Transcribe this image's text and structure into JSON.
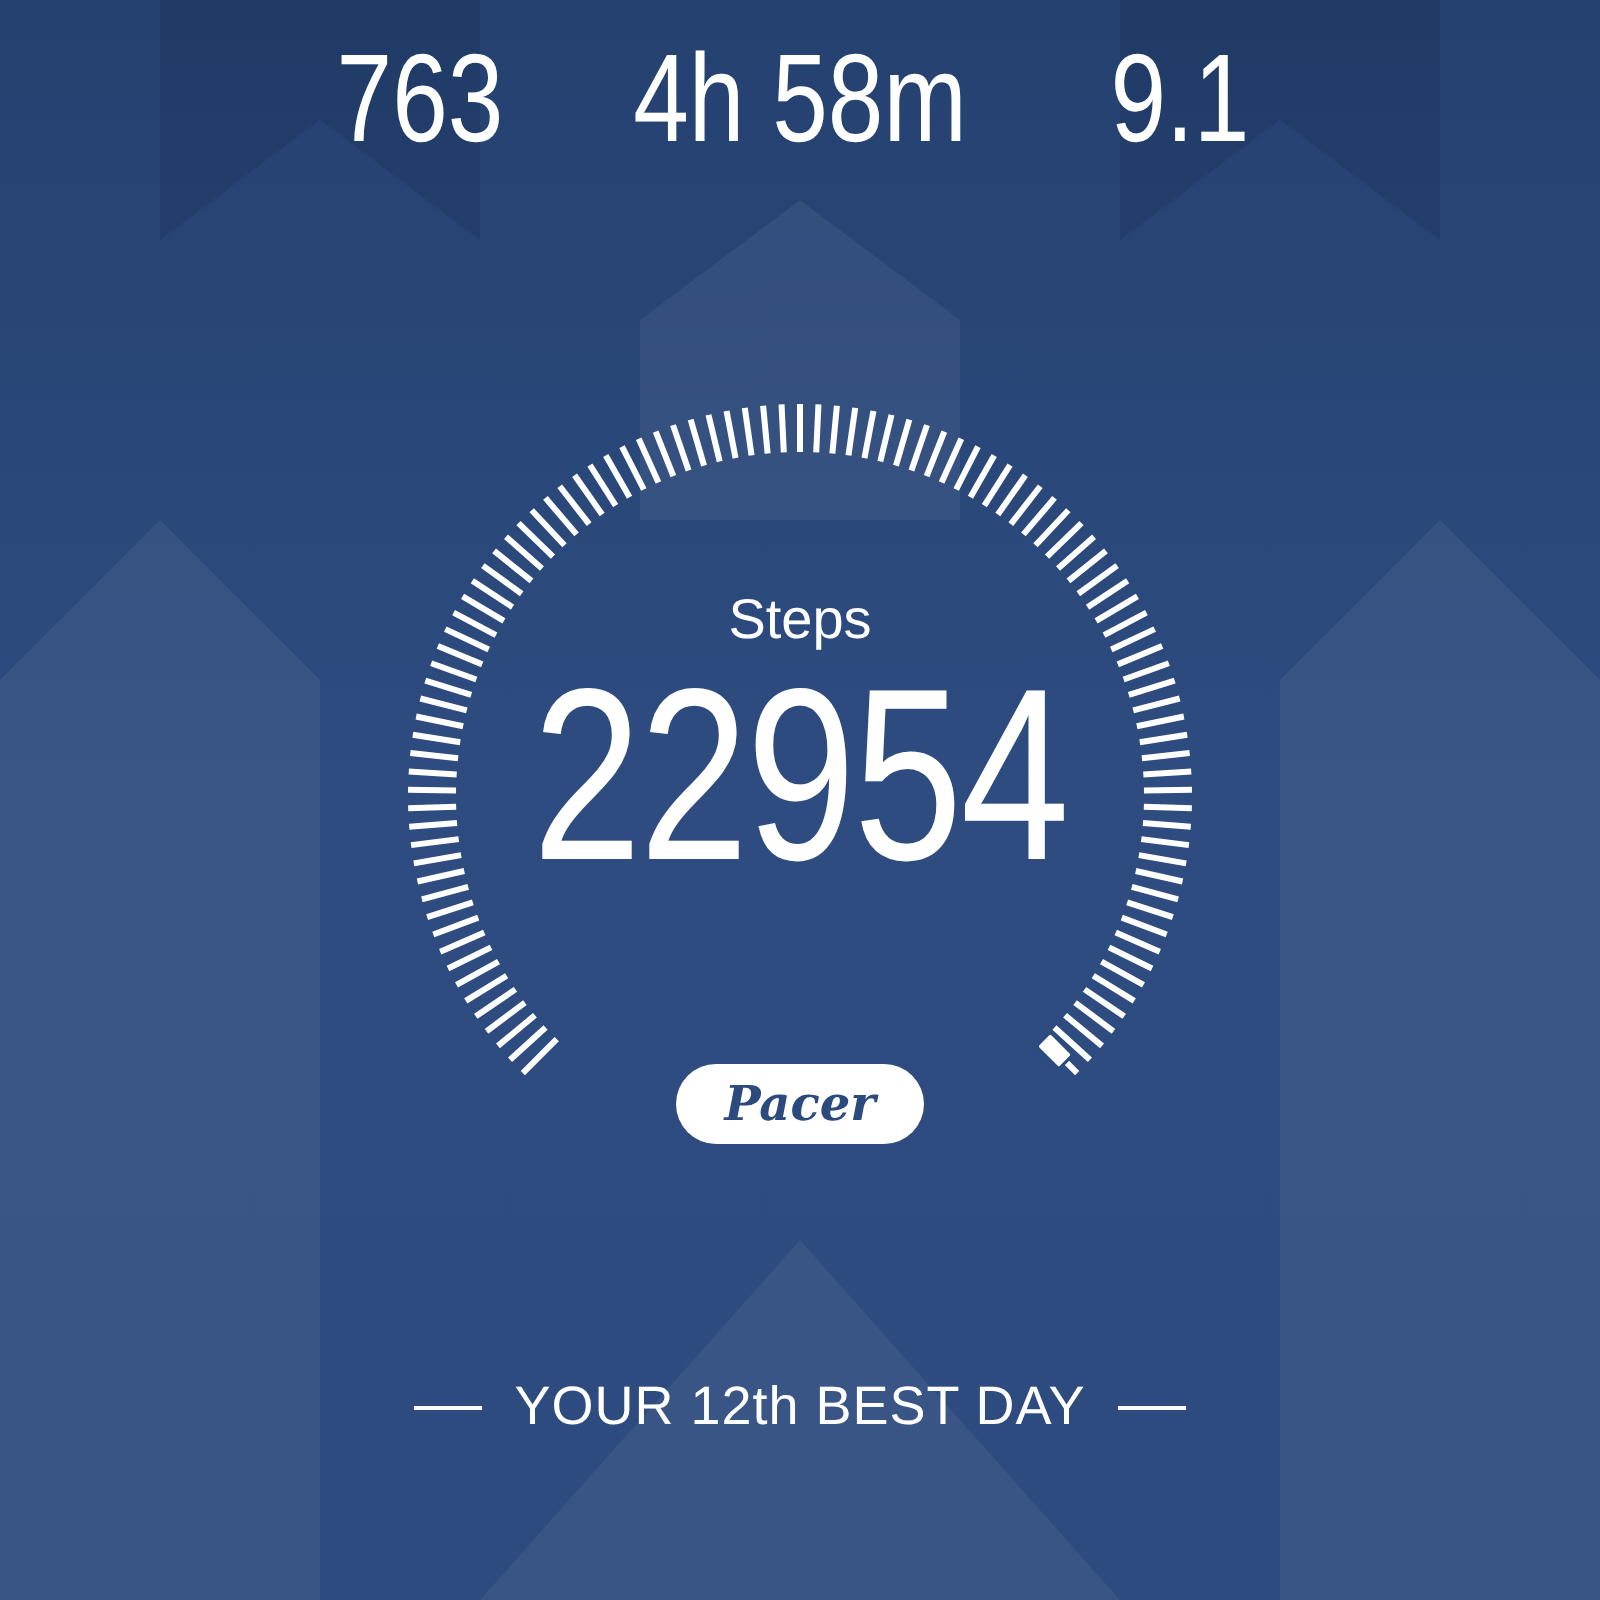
{
  "stats": [
    {
      "value": "763"
    },
    {
      "value": "4h 58m"
    },
    {
      "value": "9.1"
    }
  ],
  "steps": {
    "label": "Steps",
    "value": "22954"
  },
  "logo": {
    "text": "Pacer"
  },
  "footer": {
    "text": "YOUR 12th BEST DAY"
  }
}
